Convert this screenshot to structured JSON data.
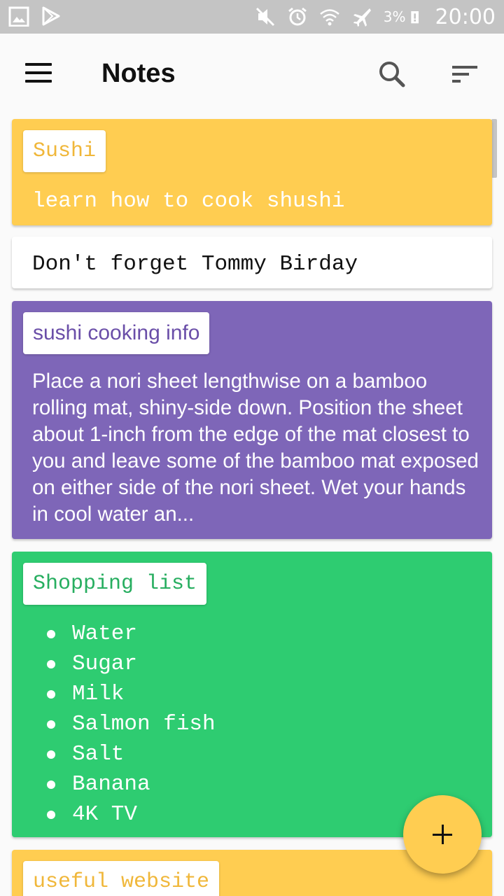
{
  "status_bar": {
    "battery_percent": "3%",
    "time": "20:00",
    "icons": [
      "gallery-icon",
      "play-store-icon",
      "mute-icon",
      "alarm-icon",
      "wifi-icon",
      "airplane-mode-icon",
      "battery-low-icon"
    ]
  },
  "app_bar": {
    "title": "Notes",
    "menu_icon": "hamburger-menu-icon",
    "search_icon": "search-icon",
    "sort_icon": "sort-icon"
  },
  "notes": [
    {
      "title": "Sushi",
      "body": "learn how to cook shushi",
      "color": "#ffcd51"
    },
    {
      "title": "",
      "body": "Don't forget Tommy Birday",
      "color": "#ffffff"
    },
    {
      "title": "sushi cooking info",
      "body": "Place a nori sheet lengthwise on a bamboo rolling mat, shiny-side down. Position the sheet about 1-inch from the edge of the mat closest to you and leave some of the bamboo mat exposed on either side of the nori sheet. Wet your hands in cool water an...",
      "color": "#7e66b8"
    },
    {
      "title": "Shopping list",
      "items": [
        "Water",
        "Sugar",
        "Milk",
        "Salmon fish",
        "Salt",
        "Banana",
        "4K TV"
      ],
      "color": "#2ecc71"
    },
    {
      "title": "useful website",
      "color": "#ffcd51"
    }
  ],
  "fab": {
    "icon": "plus-icon",
    "color": "#ffcd51"
  }
}
